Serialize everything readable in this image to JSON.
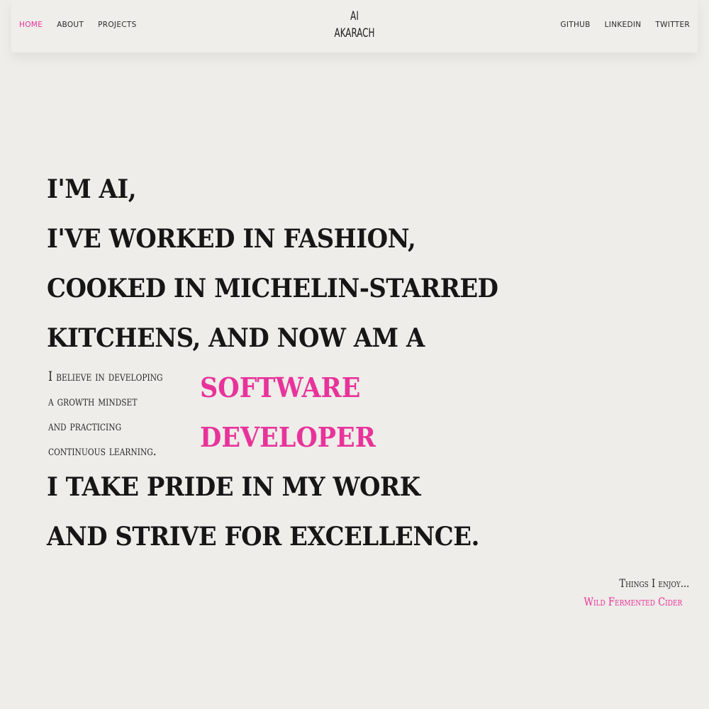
{
  "nav": {
    "left": [
      "HOME",
      "ABOUT",
      "PROJECTS"
    ],
    "right": [
      "GITHUB",
      "LINKEDIN",
      "TWITTER"
    ],
    "brand_line1": "AI",
    "brand_line2": "AKARACH"
  },
  "hero": {
    "lines": [
      "I'M AI,",
      "I'VE WORKED IN FASHION,",
      "COOKED IN MICHELIN-STARRED",
      "KITCHENS, AND NOW AM A"
    ],
    "belief_lines": [
      "I believe in developing",
      "a growth mindset",
      "and practicing",
      "continuous learning."
    ],
    "role_lines": [
      "SOFTWARE",
      "DEVELOPER"
    ],
    "closing_lines": [
      "I TAKE PRIDE IN MY WORK",
      "AND STRIVE FOR EXCELLENCE."
    ]
  },
  "enjoy": {
    "label": "Things I enjoy...",
    "item": "Wild Fermented Cider"
  },
  "colors": {
    "accent": "#e8339a",
    "background": "#eeede9",
    "text": "#141414"
  }
}
